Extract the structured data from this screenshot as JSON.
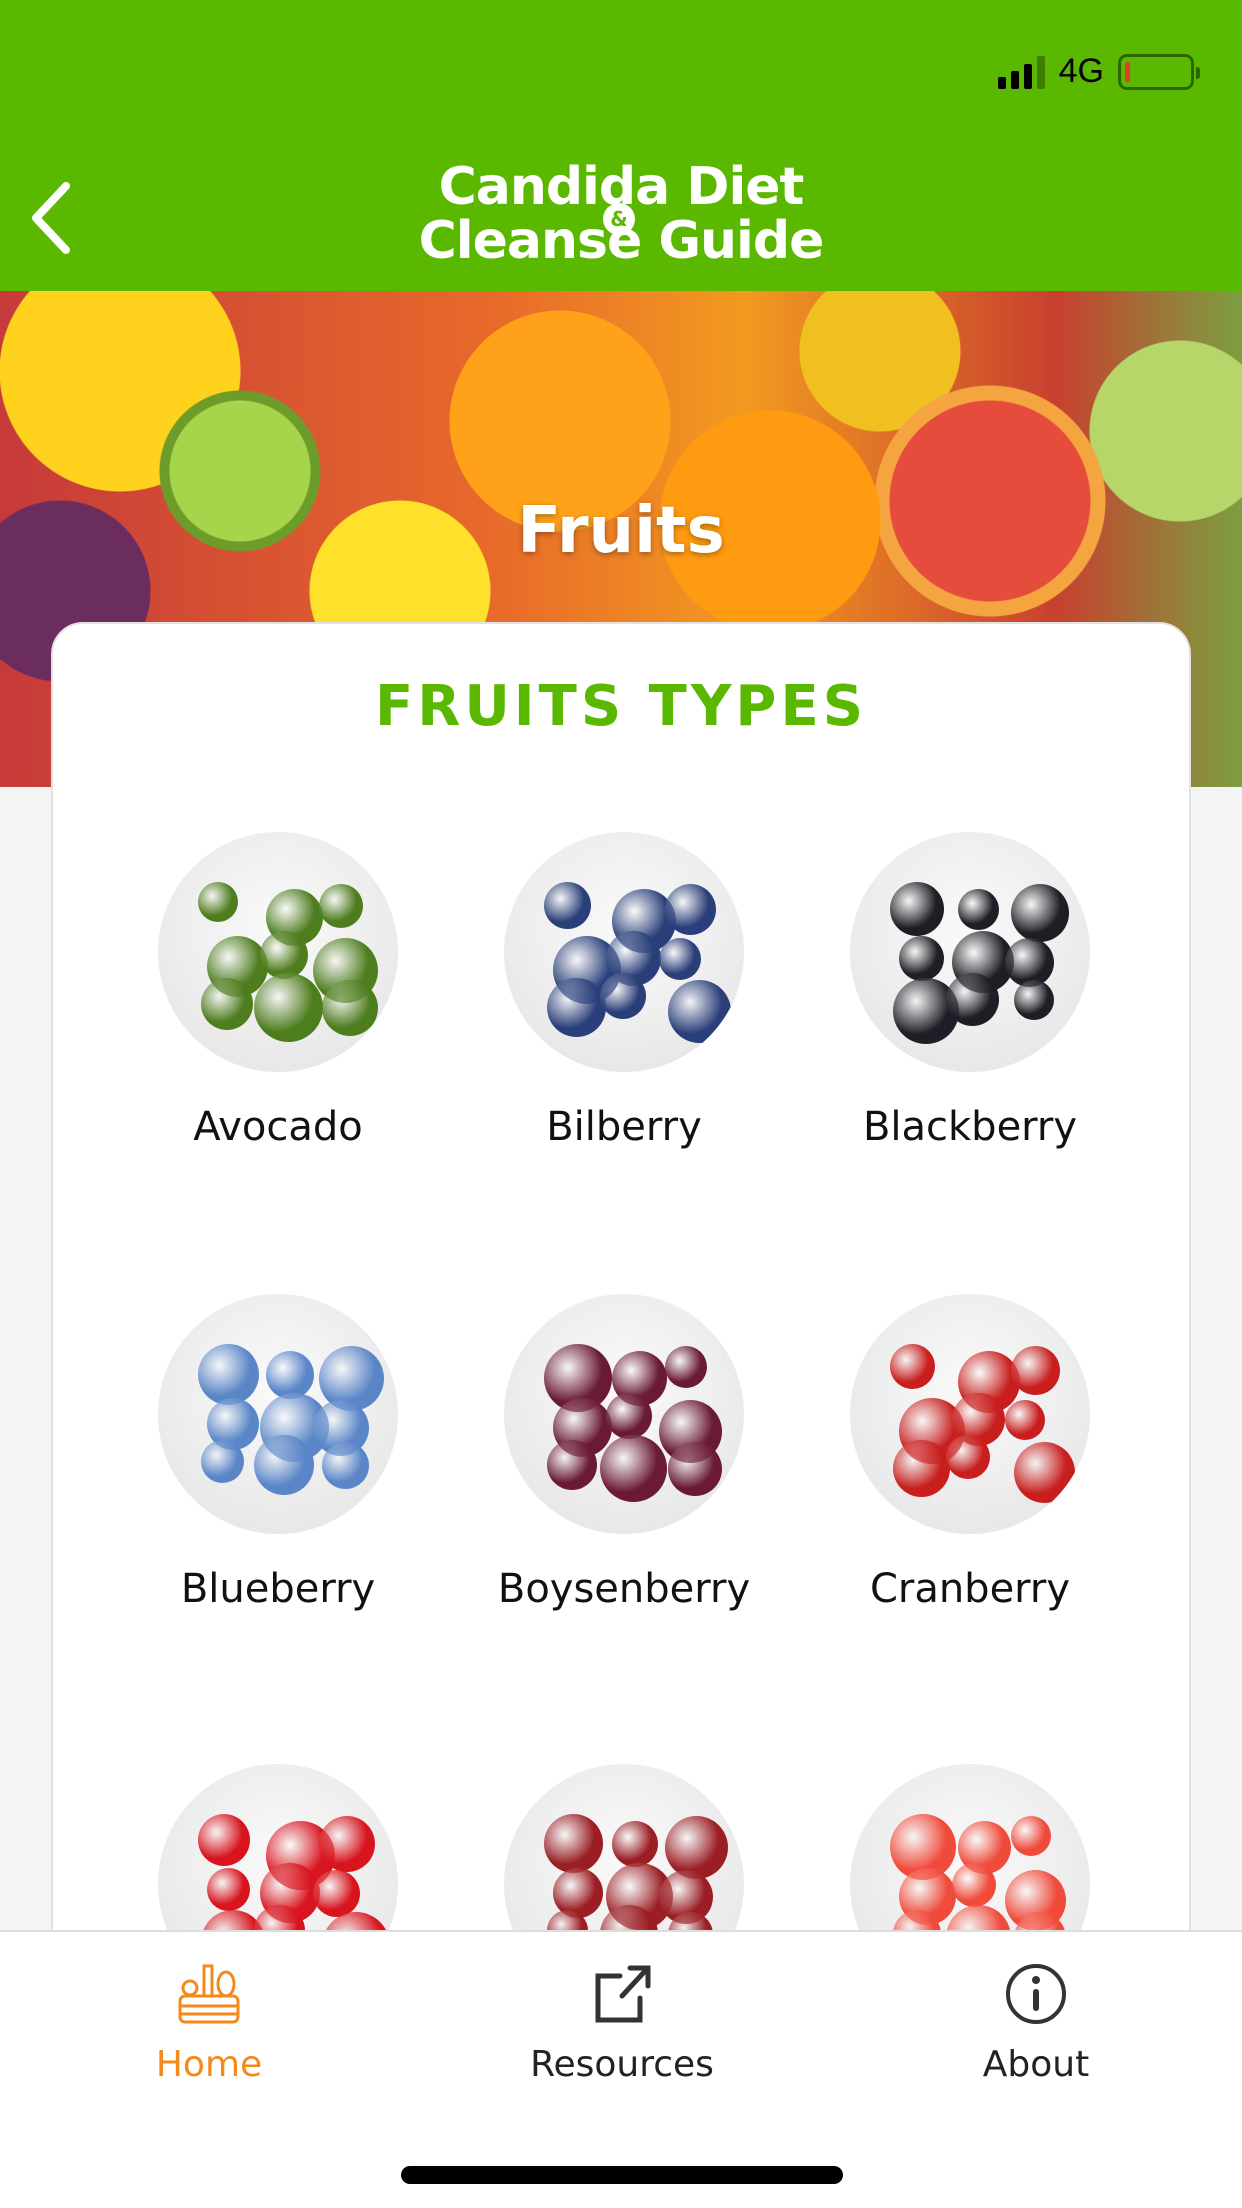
{
  "status_bar": {
    "network": "4G",
    "signal_bars": 3,
    "battery_level": "low"
  },
  "header": {
    "title_line1": "Candida Diet",
    "title_amp": "&",
    "title_line2": "Cleanse Guide",
    "back_icon": "chevron-left-icon"
  },
  "hero": {
    "title": "Fruits"
  },
  "card": {
    "title": "FRUITS TYPES"
  },
  "fruits": [
    {
      "name": "Avocado",
      "color": "#4e7d1e"
    },
    {
      "name": "Bilberry",
      "color": "#2a3f7a"
    },
    {
      "name": "Blackberry",
      "color": "#1e1e26"
    },
    {
      "name": "Blueberry",
      "color": "#5a86c8"
    },
    {
      "name": "Boysenberry",
      "color": "#6a1a36"
    },
    {
      "name": "Cranberry",
      "color": "#c81e1e"
    },
    {
      "name": "",
      "color": "#d8141e"
    },
    {
      "name": "",
      "color": "#9a1e24"
    },
    {
      "name": "",
      "color": "#f04a3a"
    }
  ],
  "tabbar": {
    "items": [
      {
        "label": "Home",
        "icon": "basket-icon",
        "active": true
      },
      {
        "label": "Resources",
        "icon": "external-link-icon",
        "active": false
      },
      {
        "label": "About",
        "icon": "info-icon",
        "active": false
      }
    ]
  },
  "colors": {
    "primary": "#5ab800",
    "accent": "#f28a1e"
  }
}
